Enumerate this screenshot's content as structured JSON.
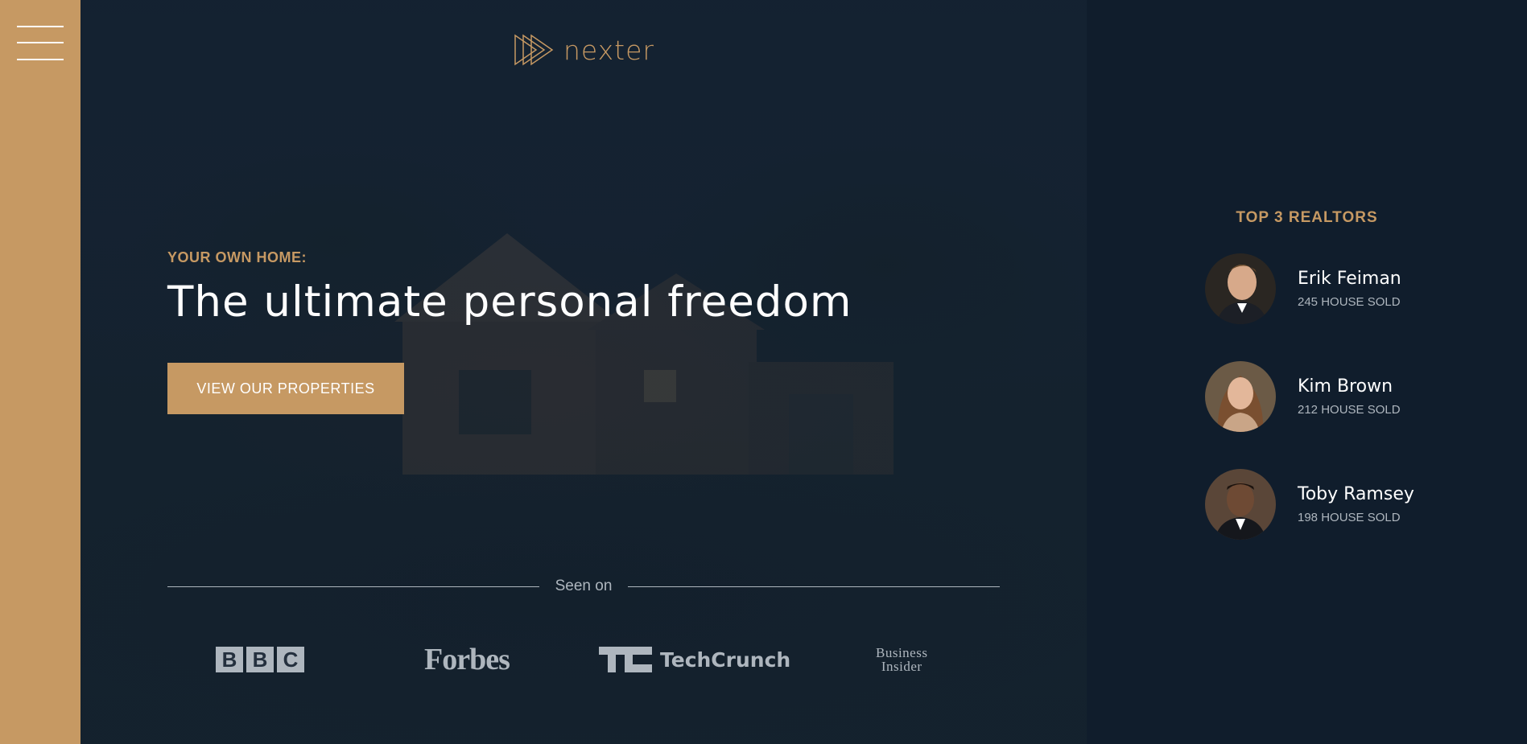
{
  "nav": {
    "menu_icon": "hamburger-icon"
  },
  "brand": {
    "logo_icon": "triple-triangle-icon",
    "name": "nexter"
  },
  "hero": {
    "subtitle": "YOUR OWN HOME:",
    "title": "The ultimate personal freedom",
    "cta_label": "VIEW OUR PROPERTIES"
  },
  "seen_on": {
    "label": "Seen on",
    "logos": [
      "BBC",
      "Forbes",
      "TechCrunch",
      "Business Insider"
    ],
    "bbc_letters": [
      "B",
      "B",
      "C"
    ],
    "forbes": "Forbes",
    "techcrunch": "TechCrunch",
    "insider_line1": "Business",
    "insider_line2": "Insider"
  },
  "realtors": {
    "heading": "TOP 3 REALTORS",
    "items": [
      {
        "name": "Erik Feiman",
        "sold": "245 HOUSE SOLD"
      },
      {
        "name": "Kim Brown",
        "sold": "212 HOUSE SOLD"
      },
      {
        "name": "Toby Ramsey",
        "sold": "198 HOUSE SOLD"
      }
    ]
  },
  "colors": {
    "primary": "#c69963",
    "dark": "#101d2c",
    "grey": "#aeb6be",
    "white": "#ffffff"
  }
}
